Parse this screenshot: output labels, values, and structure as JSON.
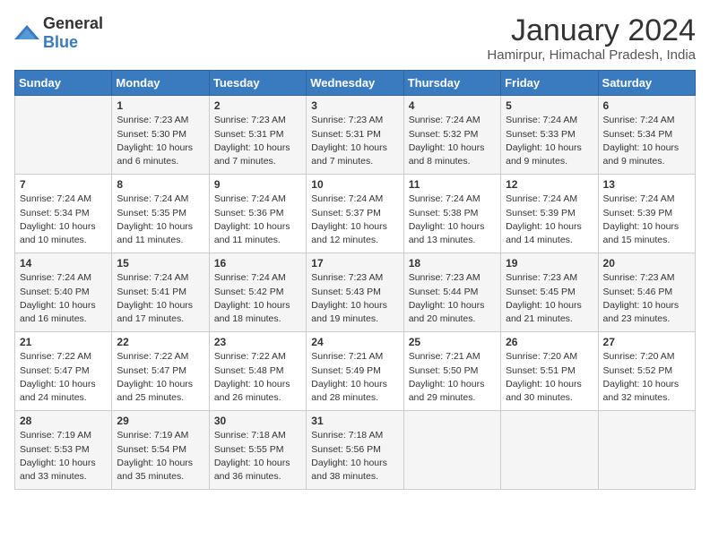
{
  "logo": {
    "general": "General",
    "blue": "Blue"
  },
  "header": {
    "title": "January 2024",
    "subtitle": "Hamirpur, Himachal Pradesh, India"
  },
  "weekdays": [
    "Sunday",
    "Monday",
    "Tuesday",
    "Wednesday",
    "Thursday",
    "Friday",
    "Saturday"
  ],
  "weeks": [
    [
      {
        "day": "",
        "sunrise": "",
        "sunset": "",
        "daylight": ""
      },
      {
        "day": "1",
        "sunrise": "Sunrise: 7:23 AM",
        "sunset": "Sunset: 5:30 PM",
        "daylight": "Daylight: 10 hours and 6 minutes."
      },
      {
        "day": "2",
        "sunrise": "Sunrise: 7:23 AM",
        "sunset": "Sunset: 5:31 PM",
        "daylight": "Daylight: 10 hours and 7 minutes."
      },
      {
        "day": "3",
        "sunrise": "Sunrise: 7:23 AM",
        "sunset": "Sunset: 5:31 PM",
        "daylight": "Daylight: 10 hours and 7 minutes."
      },
      {
        "day": "4",
        "sunrise": "Sunrise: 7:24 AM",
        "sunset": "Sunset: 5:32 PM",
        "daylight": "Daylight: 10 hours and 8 minutes."
      },
      {
        "day": "5",
        "sunrise": "Sunrise: 7:24 AM",
        "sunset": "Sunset: 5:33 PM",
        "daylight": "Daylight: 10 hours and 9 minutes."
      },
      {
        "day": "6",
        "sunrise": "Sunrise: 7:24 AM",
        "sunset": "Sunset: 5:34 PM",
        "daylight": "Daylight: 10 hours and 9 minutes."
      }
    ],
    [
      {
        "day": "7",
        "sunrise": "Sunrise: 7:24 AM",
        "sunset": "Sunset: 5:34 PM",
        "daylight": "Daylight: 10 hours and 10 minutes."
      },
      {
        "day": "8",
        "sunrise": "Sunrise: 7:24 AM",
        "sunset": "Sunset: 5:35 PM",
        "daylight": "Daylight: 10 hours and 11 minutes."
      },
      {
        "day": "9",
        "sunrise": "Sunrise: 7:24 AM",
        "sunset": "Sunset: 5:36 PM",
        "daylight": "Daylight: 10 hours and 11 minutes."
      },
      {
        "day": "10",
        "sunrise": "Sunrise: 7:24 AM",
        "sunset": "Sunset: 5:37 PM",
        "daylight": "Daylight: 10 hours and 12 minutes."
      },
      {
        "day": "11",
        "sunrise": "Sunrise: 7:24 AM",
        "sunset": "Sunset: 5:38 PM",
        "daylight": "Daylight: 10 hours and 13 minutes."
      },
      {
        "day": "12",
        "sunrise": "Sunrise: 7:24 AM",
        "sunset": "Sunset: 5:39 PM",
        "daylight": "Daylight: 10 hours and 14 minutes."
      },
      {
        "day": "13",
        "sunrise": "Sunrise: 7:24 AM",
        "sunset": "Sunset: 5:39 PM",
        "daylight": "Daylight: 10 hours and 15 minutes."
      }
    ],
    [
      {
        "day": "14",
        "sunrise": "Sunrise: 7:24 AM",
        "sunset": "Sunset: 5:40 PM",
        "daylight": "Daylight: 10 hours and 16 minutes."
      },
      {
        "day": "15",
        "sunrise": "Sunrise: 7:24 AM",
        "sunset": "Sunset: 5:41 PM",
        "daylight": "Daylight: 10 hours and 17 minutes."
      },
      {
        "day": "16",
        "sunrise": "Sunrise: 7:24 AM",
        "sunset": "Sunset: 5:42 PM",
        "daylight": "Daylight: 10 hours and 18 minutes."
      },
      {
        "day": "17",
        "sunrise": "Sunrise: 7:23 AM",
        "sunset": "Sunset: 5:43 PM",
        "daylight": "Daylight: 10 hours and 19 minutes."
      },
      {
        "day": "18",
        "sunrise": "Sunrise: 7:23 AM",
        "sunset": "Sunset: 5:44 PM",
        "daylight": "Daylight: 10 hours and 20 minutes."
      },
      {
        "day": "19",
        "sunrise": "Sunrise: 7:23 AM",
        "sunset": "Sunset: 5:45 PM",
        "daylight": "Daylight: 10 hours and 21 minutes."
      },
      {
        "day": "20",
        "sunrise": "Sunrise: 7:23 AM",
        "sunset": "Sunset: 5:46 PM",
        "daylight": "Daylight: 10 hours and 23 minutes."
      }
    ],
    [
      {
        "day": "21",
        "sunrise": "Sunrise: 7:22 AM",
        "sunset": "Sunset: 5:47 PM",
        "daylight": "Daylight: 10 hours and 24 minutes."
      },
      {
        "day": "22",
        "sunrise": "Sunrise: 7:22 AM",
        "sunset": "Sunset: 5:47 PM",
        "daylight": "Daylight: 10 hours and 25 minutes."
      },
      {
        "day": "23",
        "sunrise": "Sunrise: 7:22 AM",
        "sunset": "Sunset: 5:48 PM",
        "daylight": "Daylight: 10 hours and 26 minutes."
      },
      {
        "day": "24",
        "sunrise": "Sunrise: 7:21 AM",
        "sunset": "Sunset: 5:49 PM",
        "daylight": "Daylight: 10 hours and 28 minutes."
      },
      {
        "day": "25",
        "sunrise": "Sunrise: 7:21 AM",
        "sunset": "Sunset: 5:50 PM",
        "daylight": "Daylight: 10 hours and 29 minutes."
      },
      {
        "day": "26",
        "sunrise": "Sunrise: 7:20 AM",
        "sunset": "Sunset: 5:51 PM",
        "daylight": "Daylight: 10 hours and 30 minutes."
      },
      {
        "day": "27",
        "sunrise": "Sunrise: 7:20 AM",
        "sunset": "Sunset: 5:52 PM",
        "daylight": "Daylight: 10 hours and 32 minutes."
      }
    ],
    [
      {
        "day": "28",
        "sunrise": "Sunrise: 7:19 AM",
        "sunset": "Sunset: 5:53 PM",
        "daylight": "Daylight: 10 hours and 33 minutes."
      },
      {
        "day": "29",
        "sunrise": "Sunrise: 7:19 AM",
        "sunset": "Sunset: 5:54 PM",
        "daylight": "Daylight: 10 hours and 35 minutes."
      },
      {
        "day": "30",
        "sunrise": "Sunrise: 7:18 AM",
        "sunset": "Sunset: 5:55 PM",
        "daylight": "Daylight: 10 hours and 36 minutes."
      },
      {
        "day": "31",
        "sunrise": "Sunrise: 7:18 AM",
        "sunset": "Sunset: 5:56 PM",
        "daylight": "Daylight: 10 hours and 38 minutes."
      },
      {
        "day": "",
        "sunrise": "",
        "sunset": "",
        "daylight": ""
      },
      {
        "day": "",
        "sunrise": "",
        "sunset": "",
        "daylight": ""
      },
      {
        "day": "",
        "sunrise": "",
        "sunset": "",
        "daylight": ""
      }
    ]
  ]
}
